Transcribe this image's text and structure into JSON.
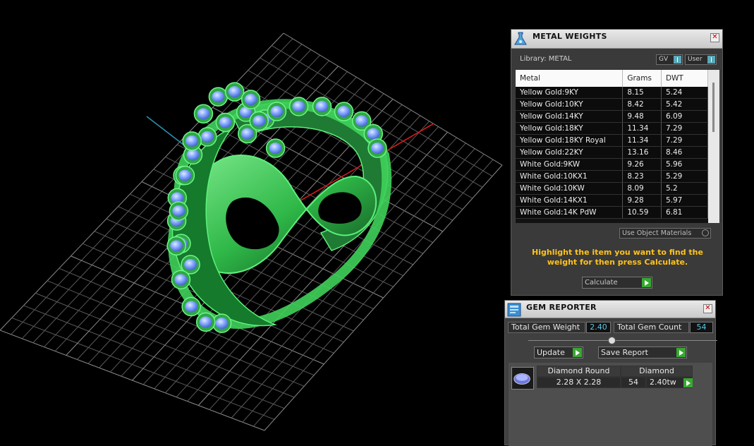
{
  "metal_weights": {
    "title": "METAL WEIGHTS",
    "library_label": "Library: METAL",
    "gv_label": "GV",
    "user_label": "User",
    "columns": [
      "Metal",
      "Grams",
      "DWT"
    ],
    "rows": [
      [
        "Yellow Gold:9KY",
        "8.15",
        "5.24"
      ],
      [
        "Yellow Gold:10KY",
        "8.42",
        "5.42"
      ],
      [
        "Yellow Gold:14KY",
        "9.48",
        "6.09"
      ],
      [
        "Yellow Gold:18KY",
        "11.34",
        "7.29"
      ],
      [
        "Yellow Gold:18KY Royal",
        "11.34",
        "7.29"
      ],
      [
        "Yellow Gold:22KY",
        "13.16",
        "8.46"
      ],
      [
        "White Gold:9KW",
        "9.26",
        "5.96"
      ],
      [
        "White Gold:10KX1",
        "8.23",
        "5.29"
      ],
      [
        "White Gold:10KW",
        "8.09",
        "5.2"
      ],
      [
        "White Gold:14KX1",
        "9.28",
        "5.97"
      ],
      [
        "White Gold:14K PdW",
        "10.59",
        "6.81"
      ]
    ],
    "use_object_materials": "Use Object Materials",
    "hint": "Highlight the item you want to find the weight for then press Calculate.",
    "calculate_label": "Calculate"
  },
  "gem_reporter": {
    "title": "GEM REPORTER",
    "total_weight_label": "Total Gem Weight",
    "total_weight_value": "2.40",
    "total_count_label": "Total Gem Count",
    "total_count_value": "54",
    "update_label": "Update",
    "save_report_label": "Save Report",
    "gem": {
      "shape": "Diamond Round",
      "material": "Diamond",
      "size": "2.28 X 2.28",
      "count": "54",
      "weight": "2.40tw"
    }
  },
  "colors": {
    "hint_text": "#ffc21a",
    "ring_green": "#3fd15a",
    "gem_blue": "#7ea8ff",
    "axis_red": "#d21a1a",
    "axis_blue": "#2a8fb0"
  }
}
